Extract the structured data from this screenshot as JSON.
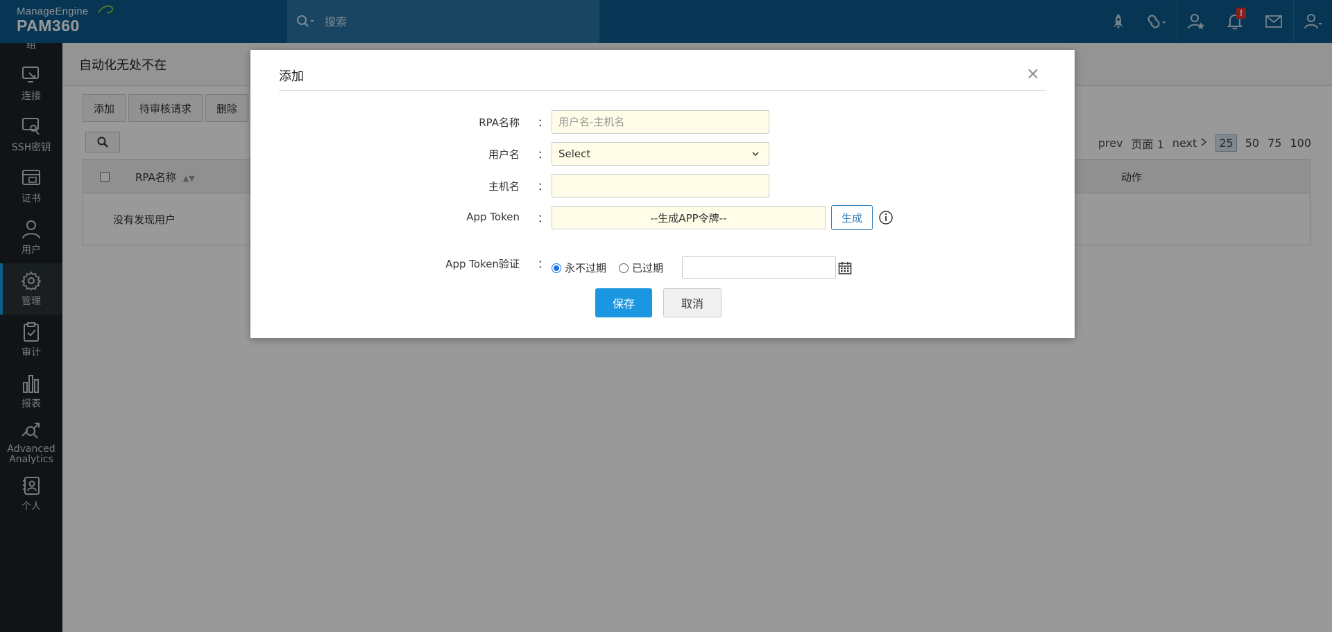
{
  "header": {
    "brand": "ManageEngine",
    "product": "PAM360",
    "search_placeholder": "搜索",
    "notification_badge": "!"
  },
  "sidebar": {
    "items": [
      {
        "label": "组",
        "icon": "group-icon"
      },
      {
        "label": "连接",
        "icon": "connection-icon"
      },
      {
        "label": "SSH密钥",
        "icon": "ssh-key-icon"
      },
      {
        "label": "证书",
        "icon": "certificate-icon"
      },
      {
        "label": "用户",
        "icon": "user-icon"
      },
      {
        "label": "管理",
        "icon": "gear-icon",
        "active": true
      },
      {
        "label": "审计",
        "icon": "audit-clipboard-icon"
      },
      {
        "label": "报表",
        "icon": "report-bar-chart-icon"
      },
      {
        "label": "Advanced Analytics",
        "icon": "analytics-icon"
      },
      {
        "label": "个人",
        "icon": "personal-icon"
      }
    ]
  },
  "page": {
    "title": "自动化无处不在",
    "toolbar": {
      "add": "添加",
      "pending": "待审核请求",
      "delete": "删除"
    },
    "pager": {
      "prev": "prev",
      "page": "页面 1",
      "next": "next",
      "sizes": [
        "25",
        "50",
        "75",
        "100"
      ],
      "active_size": "25"
    },
    "table": {
      "col_name": "RPA名称",
      "col_action": "动作",
      "empty": "没有发现用户"
    }
  },
  "modal": {
    "title": "添加",
    "close": "×",
    "fields": {
      "rpa_name_label": "RPA名称",
      "rpa_name_placeholder": "用户名-主机名",
      "username_label": "用户名",
      "username_value": "Select",
      "hostname_label": "主机名",
      "hostname_value": "",
      "token_label": "App Token",
      "token_value": "--生成APP令牌--",
      "generate": "生成",
      "validity_label": "App Token验证",
      "never_expire": "永不过期",
      "expired": "已过期",
      "colon": "："
    },
    "save": "保存",
    "cancel": "取消"
  },
  "colors": {
    "topbar": "#0c5a8c",
    "sidebar": "#1b2227",
    "accent": "#1a97e0"
  }
}
